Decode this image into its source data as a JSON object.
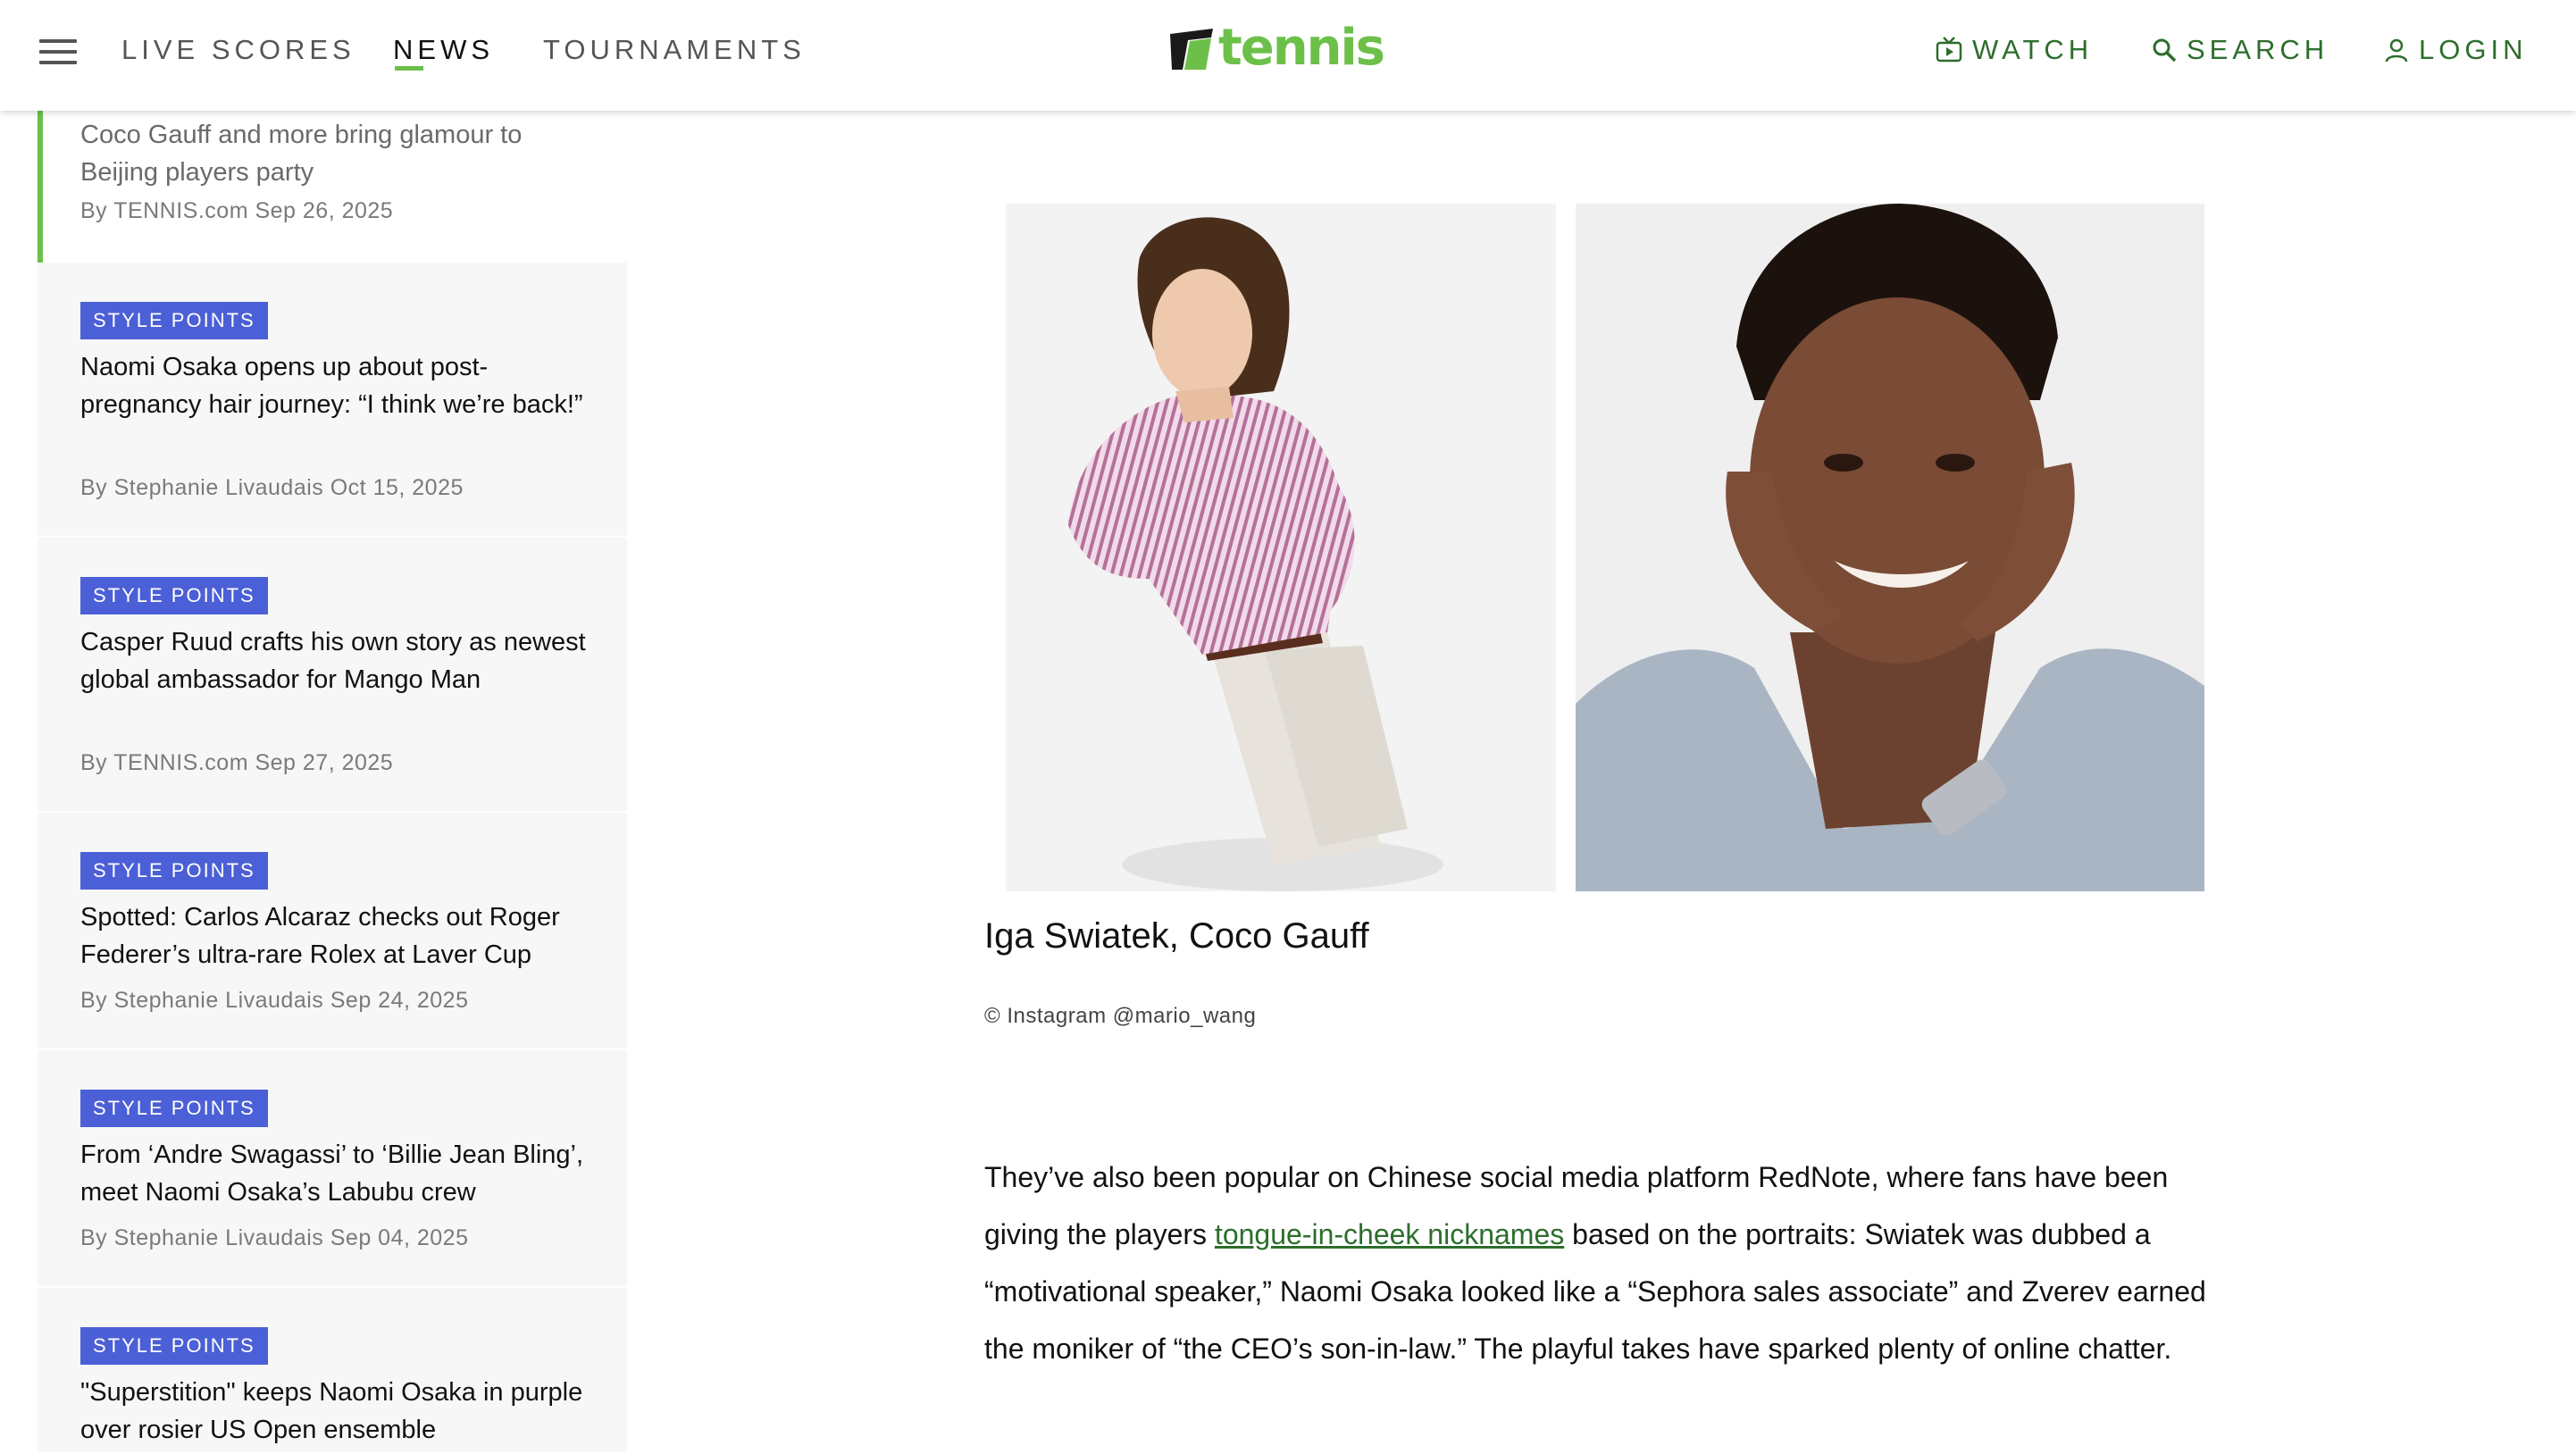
{
  "header": {
    "nav": [
      "LIVE SCORES",
      "NEWS",
      "TOURNAMENTS"
    ],
    "logo_text": "tennis",
    "watch_label": "WATCH",
    "search_label": "SEARCH",
    "login_label": "LOGIN",
    "brand_color": "#6cc04a",
    "icons": [
      "hamburger-menu-icon",
      "tv-icon",
      "search-icon",
      "user-icon"
    ]
  },
  "sidebar": {
    "first": {
      "title": "Coco Gauff and more bring glamour to Beijing players party",
      "meta": "By TENNIS.com Sep 26, 2025"
    },
    "items": [
      {
        "badge": "STYLE POINTS",
        "title": "Naomi Osaka opens up about post-pregnancy hair journey: “I think we’re back!”",
        "meta": "By Stephanie Livaudais Oct 15, 2025"
      },
      {
        "badge": "STYLE POINTS",
        "title": "Casper Ruud crafts his own story as newest global ambassador for Mango Man",
        "meta": "By TENNIS.com Sep 27, 2025"
      },
      {
        "badge": "STYLE POINTS",
        "title": "Spotted: Carlos Alcaraz checks out Roger Federer’s ultra-rare Rolex at Laver Cup",
        "meta": "By Stephanie Livaudais Sep 24, 2025"
      },
      {
        "badge": "STYLE POINTS",
        "title": "From ‘Andre Swagassi’ to ‘Billie Jean Bling’, meet Naomi Osaka’s Labubu crew",
        "meta": "By Stephanie Livaudais Sep 04, 2025"
      },
      {
        "badge": "STYLE POINTS",
        "title": "\"Superstition\" keeps Naomi Osaka in purple over rosier US Open ensemble",
        "meta": ""
      }
    ]
  },
  "article": {
    "caption": "Iga Swiatek, Coco Gauff",
    "credit": "© Instagram @mario_wang",
    "para_before_link": "They’ve also been popular on Chinese social media platform RedNote, where fans have been giving the players ",
    "link_text": "tongue-in-cheek nicknames",
    "para_after_link": " based on the portraits: Swiatek was dubbed a “motivational speaker,” Naomi Osaka looked like a “Sephora sales associate” and Zverev earned the moniker of “the CEO’s son-in-law.” The playful takes have sparked plenty of online chatter."
  }
}
